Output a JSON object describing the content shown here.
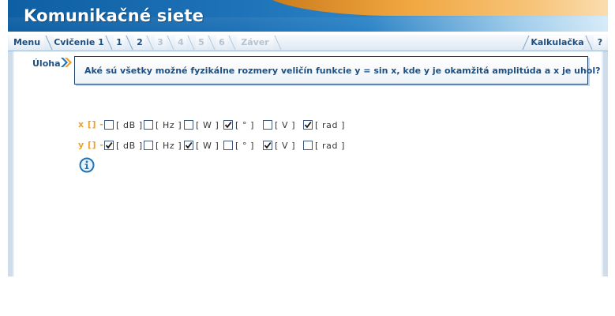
{
  "app": {
    "title": "Komunikačné siete"
  },
  "tabs": {
    "menu": "Menu",
    "exercise": "Cvičenie 1",
    "steps": [
      "1",
      "2",
      "3",
      "4",
      "5",
      "6"
    ],
    "end": "Záver",
    "calculator": "Kalkulačka",
    "help": "?"
  },
  "task": {
    "label": "Úloha",
    "question": "Aké sú všetky možné fyzikálne rozmery veličín funkcie y = sin x, kde y je okamžitá amplitúda a x je uhol?"
  },
  "rows": [
    {
      "label": "x [] -",
      "options": [
        {
          "label": "[ dB ]",
          "checked": false
        },
        {
          "label": "[ Hz ]",
          "checked": false
        },
        {
          "label": "[ W ]",
          "checked": false
        },
        {
          "label": "[ ° ]",
          "checked": true
        },
        {
          "label": "[ V ]",
          "checked": false
        },
        {
          "label": "[ rad ]",
          "checked": true
        }
      ]
    },
    {
      "label": "y [] -",
      "options": [
        {
          "label": "[ dB ]",
          "checked": true
        },
        {
          "label": "[ Hz ]",
          "checked": false
        },
        {
          "label": "[ W ]",
          "checked": true
        },
        {
          "label": "[ ° ]",
          "checked": false
        },
        {
          "label": "[ V ]",
          "checked": true
        },
        {
          "label": "[ rad ]",
          "checked": false
        }
      ]
    }
  ],
  "colors": {
    "brand_blue": "#1d4f82",
    "accent_orange": "#f0a020",
    "banner_blue": "#1f73b8"
  },
  "icons": {
    "task_arrow": "double-chevron-right-icon",
    "info": "info-icon"
  }
}
